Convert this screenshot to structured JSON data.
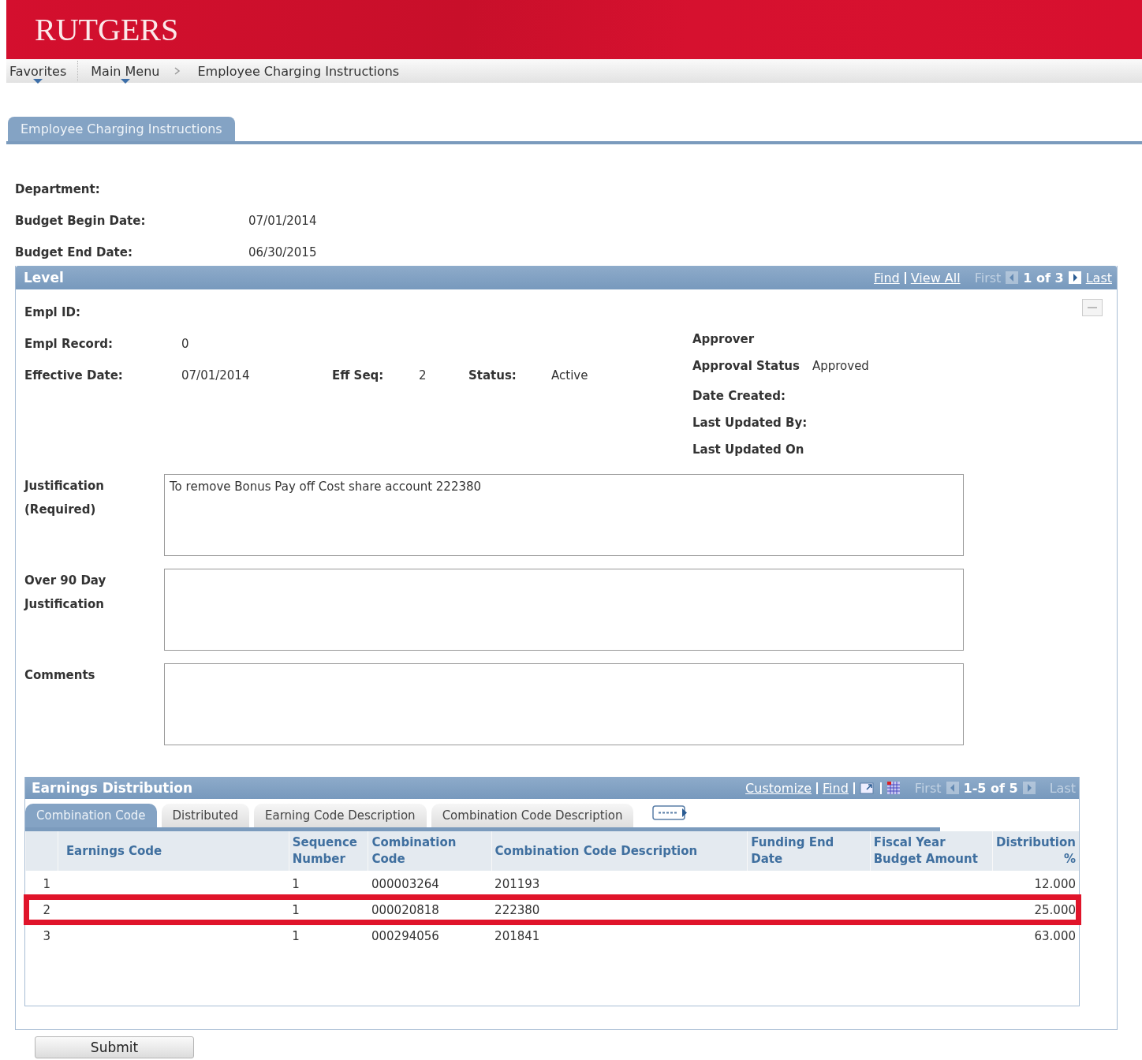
{
  "header": {
    "logo": "RUTGERS"
  },
  "nav": {
    "items": [
      {
        "label": "Favorites",
        "menu": true
      },
      {
        "label": "Main Menu",
        "menu": true
      },
      {
        "label": "Employee Charging Instructions",
        "menu": false
      }
    ]
  },
  "page_tab": {
    "label": "Employee Charging Instructions",
    "selected": true
  },
  "header_fields": [
    {
      "label": "Department:"
    },
    {
      "label": "Budget Begin Date:",
      "value": "07/01/2014"
    },
    {
      "label": "Budget End Date:",
      "value": "06/30/2015"
    }
  ],
  "level": {
    "title": "Level",
    "find": "Find",
    "view_all": "View All",
    "first": "First",
    "first_disabled": true,
    "count": "1 of 3",
    "last": "Last",
    "last_disabled": false,
    "empl_id_label": "Empl ID:",
    "empl_record_label": "Empl Record:",
    "empl_record": "0",
    "effective_date_label": "Effective Date:",
    "effective_date": "07/01/2014",
    "eff_seq_label": "Eff Seq:",
    "eff_seq": "2",
    "status_label": "Status:",
    "status": "Active",
    "approver_label": "Approver",
    "approval_status_label": "Approval Status",
    "approval_status": "Approved",
    "date_created_label": "Date Created:",
    "last_updated_by_label": "Last Updated By:",
    "last_updated_on_label": "Last Updated On",
    "text_areas": [
      {
        "label": "Justification (Required)",
        "value": "To remove Bonus Pay off Cost share account 222380"
      },
      {
        "label": "Over 90 Day Justification"
      },
      {
        "label": "Comments"
      }
    ]
  },
  "grid": {
    "title": "Earnings Distribution",
    "customize": "Customize",
    "find": "Find",
    "first": "First",
    "count": "1-5 of 5",
    "last": "Last",
    "tabs": [
      {
        "label": "Combination Code",
        "selected": true
      },
      {
        "label": "Distributed",
        "selected": false
      },
      {
        "label": "Earning Code Description",
        "selected": false
      },
      {
        "label": "Combination Code Description",
        "selected": false
      }
    ],
    "columns": [
      "Earnings Code",
      "Sequence Number",
      "Combination Code",
      "Combination Code Description",
      "Funding End Date",
      "Fiscal Year Budget Amount",
      "Distribution %"
    ],
    "rows": [
      {
        "row_number": "1",
        "sequence": "1",
        "combination_code": "000003264",
        "description": "201193",
        "distribution": "12.000",
        "highlighted": false
      },
      {
        "row_number": "2",
        "sequence": "1",
        "combination_code": "000020818",
        "description": "222380",
        "distribution": "25.000",
        "highlighted": true
      },
      {
        "row_number": "3",
        "sequence": "1",
        "combination_code": "000294056",
        "description": "201841",
        "distribution": "63.000",
        "highlighted": false
      }
    ]
  },
  "submit_button": "Submit"
}
